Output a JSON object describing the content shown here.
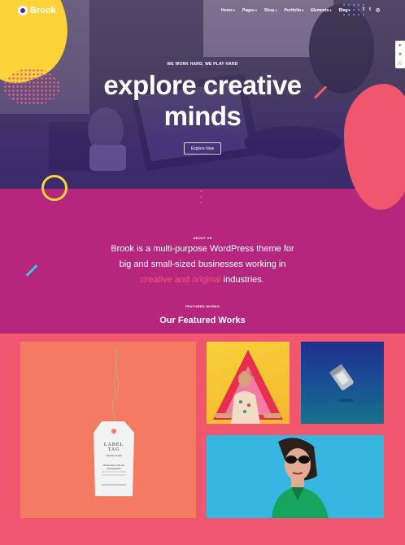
{
  "colors": {
    "hero_purple": "#3b1f8c",
    "about_magenta": "#b5267c",
    "accent_pink": "#f0566d",
    "accent_yellow": "#fcd43a",
    "accent_cyan": "#35c6e6"
  },
  "brand": {
    "logo_text": "Brook"
  },
  "nav": {
    "items": [
      "Home",
      "Pages",
      "Shop",
      "Portfolio",
      "Elements",
      "Blog"
    ],
    "social": [
      {
        "name": "facebook-icon",
        "glyph": "f"
      },
      {
        "name": "twitter-icon",
        "glyph": "t"
      },
      {
        "name": "instagram-icon",
        "glyph": "◎"
      }
    ]
  },
  "hero": {
    "tagline": "WE WORK HARD, WE PLAY HARD",
    "headline_line1": "explore creative",
    "headline_line2": "minds",
    "cta": "Explore Now"
  },
  "about": {
    "kicker": "ABOUT US",
    "text_line1": "Brook is a multi-purpose WordPress theme for",
    "text_line2": "big and small-sized businesses working in",
    "text_highlight": "creative and original",
    "text_tail": " industries."
  },
  "featured": {
    "kicker": "FEATURED WORKS",
    "title": "Our Featured Works",
    "label_tag": {
      "line1": "LABEL",
      "line2": "TAG",
      "small": "Standard design",
      "note1": "Handcrafted with ink",
      "note2": "and Ingredient"
    }
  }
}
